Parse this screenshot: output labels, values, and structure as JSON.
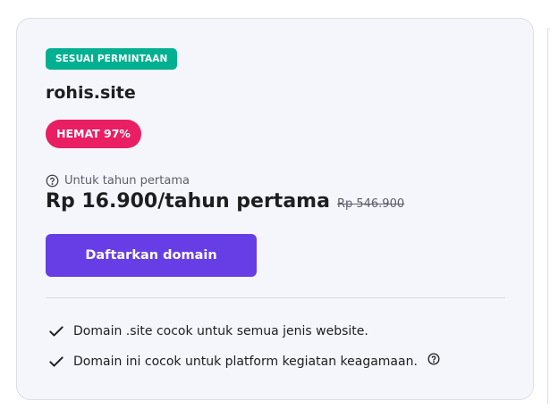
{
  "card": {
    "badge": "SESUAI PERMINTAAN",
    "domain": "rohis.site",
    "save_badge": "HEMAT 97%",
    "period_note": "Untuk tahun pertama",
    "price": "Rp 16.900/tahun pertama",
    "old_price": "Rp 546.900",
    "cta_label": "Daftarkan domain",
    "features": [
      "Domain .site cocok untuk semua jenis website.",
      "Domain ini cocok untuk platform kegiatan keagamaan."
    ]
  },
  "colors": {
    "badge_bg": "#00b090",
    "save_bg": "#e91e63",
    "cta_bg": "#673de6",
    "card_bg": "#f5f6fb"
  },
  "icons": {
    "period": "help-circle-icon",
    "feature": "checkmark-icon",
    "feature_help": "help-circle-icon"
  }
}
